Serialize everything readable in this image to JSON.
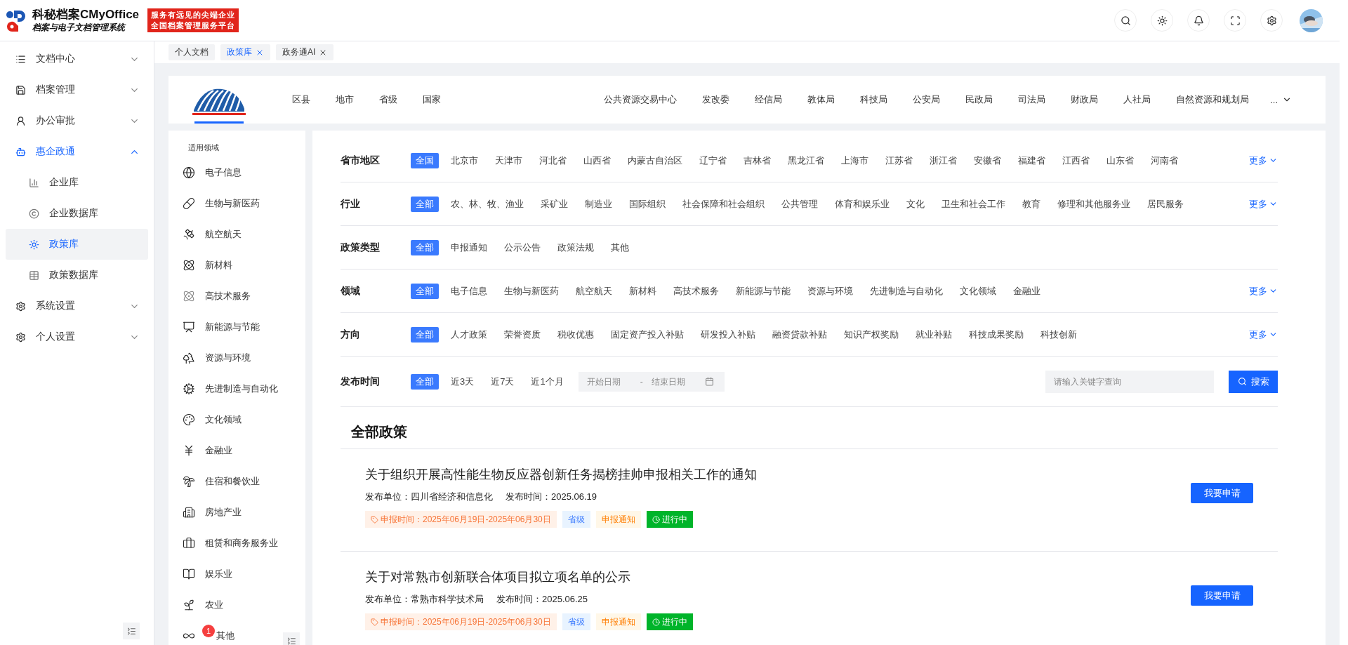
{
  "header": {
    "brand_title": "科秘档案CMyOffice",
    "brand_subtitle": "档案与电子文档管理系统",
    "slogan": [
      "服务有远见的尖端企业",
      "全国档案管理服务平台"
    ]
  },
  "sidebar": {
    "items": [
      {
        "label": "文档中心",
        "expanded": false
      },
      {
        "label": "档案管理",
        "expanded": false
      },
      {
        "label": "办公审批",
        "expanded": false
      },
      {
        "label": "惠企政通",
        "expanded": true,
        "children": [
          {
            "label": "企业库",
            "selected": false
          },
          {
            "label": "企业数据库",
            "selected": false
          },
          {
            "label": "政策库",
            "selected": true
          },
          {
            "label": "政策数据库",
            "selected": false
          }
        ]
      },
      {
        "label": "系统设置",
        "expanded": false
      },
      {
        "label": "个人设置",
        "expanded": false
      }
    ]
  },
  "tabs": [
    {
      "label": "个人文档",
      "selected": false,
      "closable": false
    },
    {
      "label": "政策库",
      "selected": true,
      "closable": true
    },
    {
      "label": "政务通AI",
      "selected": false,
      "closable": true
    }
  ],
  "nav": {
    "regions": [
      "区县",
      "地市",
      "省级",
      "国家"
    ],
    "departments": [
      "公共资源交易中心",
      "发改委",
      "经信局",
      "教体局",
      "科技局",
      "公安局",
      "民政局",
      "司法局",
      "财政局",
      "人社局",
      "自然资源和规划局"
    ],
    "more": "..."
  },
  "domains": {
    "title": "适用领域",
    "items": [
      {
        "label": "电子信息"
      },
      {
        "label": "生物与新医药"
      },
      {
        "label": "航空航天"
      },
      {
        "label": "新材料"
      },
      {
        "label": "高技术服务"
      },
      {
        "label": "新能源与节能"
      },
      {
        "label": "资源与环境"
      },
      {
        "label": "先进制造与自动化"
      },
      {
        "label": "文化领域"
      },
      {
        "label": "金融业"
      },
      {
        "label": "住宿和餐饮业"
      },
      {
        "label": "房地产业"
      },
      {
        "label": "租赁和商务服务业"
      },
      {
        "label": "娱乐业"
      },
      {
        "label": "农业"
      },
      {
        "label": "其他",
        "badge": "1"
      }
    ]
  },
  "filters": [
    {
      "label": "省市地区",
      "more": "更多",
      "options": [
        {
          "label": "全国",
          "selected": true
        },
        {
          "label": "北京市",
          "selected": false
        },
        {
          "label": "天津市",
          "selected": false
        },
        {
          "label": "河北省",
          "selected": false
        },
        {
          "label": "山西省",
          "selected": false
        },
        {
          "label": "内蒙古自治区",
          "selected": false
        },
        {
          "label": "辽宁省",
          "selected": false
        },
        {
          "label": "吉林省",
          "selected": false
        },
        {
          "label": "黑龙江省",
          "selected": false
        },
        {
          "label": "上海市",
          "selected": false
        },
        {
          "label": "江苏省",
          "selected": false
        },
        {
          "label": "浙江省",
          "selected": false
        },
        {
          "label": "安徽省",
          "selected": false
        },
        {
          "label": "福建省",
          "selected": false
        },
        {
          "label": "江西省",
          "selected": false
        },
        {
          "label": "山东省",
          "selected": false
        },
        {
          "label": "河南省",
          "selected": false
        }
      ]
    },
    {
      "label": "行业",
      "more": "更多",
      "options": [
        {
          "label": "全部",
          "selected": true
        },
        {
          "label": "农、林、牧、渔业",
          "selected": false
        },
        {
          "label": "采矿业",
          "selected": false
        },
        {
          "label": "制造业",
          "selected": false
        },
        {
          "label": "国际组织",
          "selected": false
        },
        {
          "label": "社会保障和社会组织",
          "selected": false
        },
        {
          "label": "公共管理",
          "selected": false
        },
        {
          "label": "体育和娱乐业",
          "selected": false
        },
        {
          "label": "文化",
          "selected": false
        },
        {
          "label": "卫生和社会工作",
          "selected": false
        },
        {
          "label": "教育",
          "selected": false
        },
        {
          "label": "修理和其他服务业",
          "selected": false
        },
        {
          "label": "居民服务",
          "selected": false
        }
      ]
    },
    {
      "label": "政策类型",
      "options": [
        {
          "label": "全部",
          "selected": true
        },
        {
          "label": "申报通知",
          "selected": false
        },
        {
          "label": "公示公告",
          "selected": false
        },
        {
          "label": "政策法规",
          "selected": false
        },
        {
          "label": "其他",
          "selected": false
        }
      ]
    },
    {
      "label": "领域",
      "more": "更多",
      "options": [
        {
          "label": "全部",
          "selected": true
        },
        {
          "label": "电子信息",
          "selected": false
        },
        {
          "label": "生物与新医药",
          "selected": false
        },
        {
          "label": "航空航天",
          "selected": false
        },
        {
          "label": "新材料",
          "selected": false
        },
        {
          "label": "高技术服务",
          "selected": false
        },
        {
          "label": "新能源与节能",
          "selected": false
        },
        {
          "label": "资源与环境",
          "selected": false
        },
        {
          "label": "先进制造与自动化",
          "selected": false
        },
        {
          "label": "文化领域",
          "selected": false
        },
        {
          "label": "金融业",
          "selected": false
        }
      ]
    },
    {
      "label": "方向",
      "more": "更多",
      "options": [
        {
          "label": "全部",
          "selected": true
        },
        {
          "label": "人才政策",
          "selected": false
        },
        {
          "label": "荣誉资质",
          "selected": false
        },
        {
          "label": "税收优惠",
          "selected": false
        },
        {
          "label": "固定资产投入补贴",
          "selected": false
        },
        {
          "label": "研发投入补贴",
          "selected": false
        },
        {
          "label": "融资贷款补贴",
          "selected": false
        },
        {
          "label": "知识产权奖励",
          "selected": false
        },
        {
          "label": "就业补贴",
          "selected": false
        },
        {
          "label": "科技成果奖励",
          "selected": false
        },
        {
          "label": "科技创新",
          "selected": false
        }
      ]
    }
  ],
  "date_filter": {
    "label": "发布时间",
    "options": [
      {
        "label": "全部",
        "selected": true
      },
      {
        "label": "近3天",
        "selected": false
      },
      {
        "label": "近7天",
        "selected": false
      },
      {
        "label": "近1个月",
        "selected": false
      }
    ],
    "start_placeholder": "开始日期",
    "separator": "-",
    "end_placeholder": "结束日期"
  },
  "search": {
    "placeholder": "请输入关键字查询",
    "button": "搜索"
  },
  "policies": {
    "title": "全部政策",
    "items": [
      {
        "title": "关于组织开展高性能生物反应器创新任务揭榜挂帅申报相关工作的通知",
        "unit": "发布单位：四川省经济和信息化",
        "date": "发布时间：2025.06.19",
        "action": "我要申请",
        "tags": [
          {
            "kind": "period",
            "text": "申报时间：2025年06月19日-2025年06月30日"
          },
          {
            "kind": "level",
            "text": "省级"
          },
          {
            "kind": "type",
            "text": "申报通知"
          },
          {
            "kind": "status",
            "text": "进行中"
          }
        ]
      },
      {
        "title": "关于对常熟市创新联合体项目拟立项名单的公示",
        "unit": "发布单位：常熟市科学技术局",
        "date": "发布时间：2025.06.25",
        "action": "我要申请",
        "tags": [
          {
            "kind": "period",
            "text": "申报时间：2025年06月19日-2025年06月30日"
          },
          {
            "kind": "level",
            "text": "省级"
          },
          {
            "kind": "type",
            "text": "申报通知"
          },
          {
            "kind": "status",
            "text": "进行中"
          }
        ]
      }
    ]
  }
}
